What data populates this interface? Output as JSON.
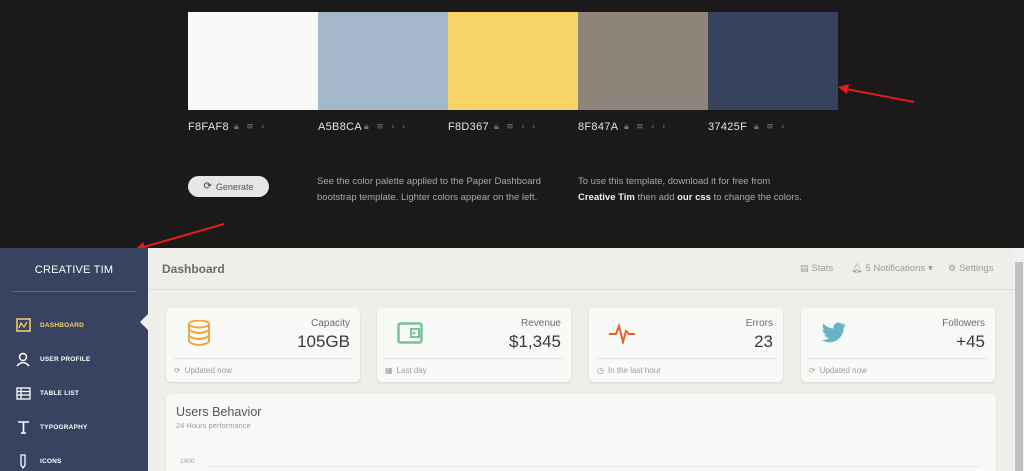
{
  "palette": {
    "swatches": [
      {
        "hex": "F8FAF8",
        "color": "#F8FAF8",
        "icons": [
          "lock-icon",
          "adjust-icon",
          "chevron-right-icon"
        ]
      },
      {
        "hex": "A5B8CA",
        "color": "#A5B8CA",
        "icons": [
          "lock-icon",
          "adjust-icon",
          "chevron-left-icon",
          "chevron-right-icon"
        ]
      },
      {
        "hex": "F8D367",
        "color": "#F8D367",
        "icons": [
          "lock-icon",
          "adjust-icon",
          "chevron-left-icon",
          "chevron-right-icon"
        ]
      },
      {
        "hex": "8F847A",
        "color": "#8F847A",
        "icons": [
          "lock-icon",
          "adjust-icon",
          "chevron-left-icon",
          "chevron-right-icon"
        ]
      },
      {
        "hex": "37425F",
        "color": "#37425F",
        "icons": [
          "lock-icon",
          "adjust-icon",
          "chevron-left-icon"
        ]
      }
    ],
    "generate_label": "Generate",
    "desc_left_1": "See the color palette applied to the Paper Dashboard",
    "desc_left_2": "bootstrap template. Lighter colors appear on the left.",
    "desc_right_1": "To use this template, download it for free from",
    "desc_right_link1": "Creative Tim",
    "desc_right_mid": " then add ",
    "desc_right_link2": "our css",
    "desc_right_end": " to change the colors."
  },
  "sidebar": {
    "brand": "CREATIVE TIM",
    "items": [
      {
        "label": "DASHBOARD",
        "icon": "chart-icon",
        "active": true
      },
      {
        "label": "USER PROFILE",
        "icon": "user-icon",
        "active": false
      },
      {
        "label": "TABLE LIST",
        "icon": "table-icon",
        "active": false
      },
      {
        "label": "TYPOGRAPHY",
        "icon": "typography-icon",
        "active": false
      },
      {
        "label": "ICONS",
        "icon": "pencil-icon",
        "active": false
      }
    ]
  },
  "header": {
    "title": "Dashboard",
    "stats": "Stats",
    "notifications": "5 Notifications",
    "settings": "Settings"
  },
  "stats": [
    {
      "label": "Capacity",
      "value": "105GB",
      "footer": "Updated now",
      "icon": "server-icon",
      "footer_icon": "refresh-icon",
      "color": "#f3a73f"
    },
    {
      "label": "Revenue",
      "value": "$1,345",
      "footer": "Last day",
      "icon": "wallet-icon",
      "footer_icon": "calendar-icon",
      "color": "#7ac29a"
    },
    {
      "label": "Errors",
      "value": "23",
      "footer": "In the last hour",
      "icon": "pulse-icon",
      "footer_icon": "clock-icon",
      "color": "#eb5e28"
    },
    {
      "label": "Followers",
      "value": "+45",
      "footer": "Updated now",
      "icon": "twitter-icon",
      "footer_icon": "refresh-icon",
      "color": "#68b3c8"
    }
  ],
  "behavior": {
    "title": "Users Behavior",
    "subtitle": "24 Hours performance",
    "y_tick": "1000"
  }
}
